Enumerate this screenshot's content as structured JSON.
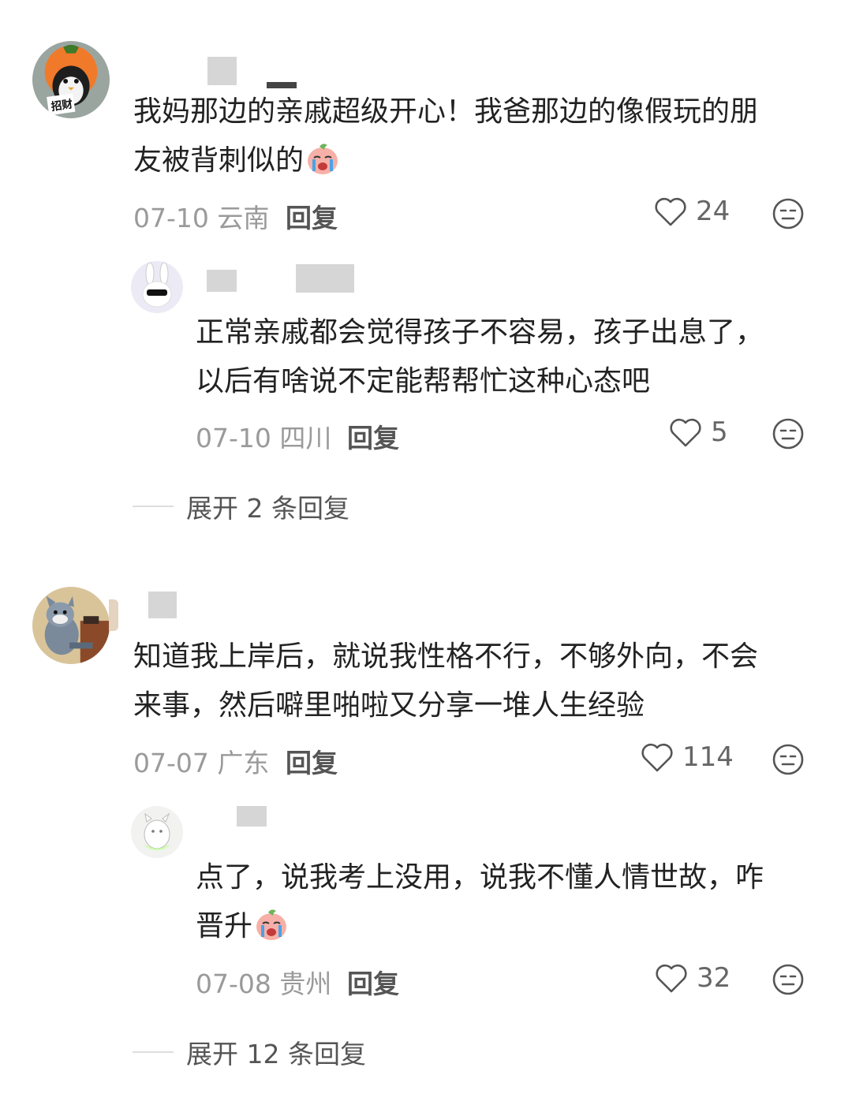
{
  "comments": [
    {
      "text_line1": "我妈那边的亲戚超级开心！我爸那边的像假玩的朋",
      "text_line2": "友被背刺似的",
      "date": "07-10",
      "location": "云南",
      "reply_label": "回复",
      "likes": "24",
      "reply": {
        "text_line1": "正常亲戚都会觉得孩子不容易，孩子出息了，",
        "text_line2": "以后有啥说不定能帮帮忙这种心态吧",
        "date": "07-10",
        "location": "四川",
        "reply_label": "回复",
        "likes": "5"
      },
      "expand_label": "展开 2 条回复"
    },
    {
      "text_line1": "知道我上岸后，就说我性格不行，不够外向，不会",
      "text_line2": "来事，然后噼里啪啦又分享一堆人生经验",
      "date": "07-07",
      "location": "广东",
      "reply_label": "回复",
      "likes": "114",
      "reply": {
        "text_line1": "点了，说我考上没用，说我不懂人情世故，咋",
        "text_line2": "晋升",
        "date": "07-08",
        "location": "贵州",
        "reply_label": "回复",
        "likes": "32"
      },
      "expand_label": "展开 12 条回复"
    }
  ],
  "icons": {
    "like": "heart-outline-icon",
    "dislike": "neutral-face-icon",
    "emoji": "crying-peach-emoji"
  },
  "colors": {
    "meta_text": "#9a9a9a",
    "body_text": "#222222",
    "icon_stroke": "#555555"
  }
}
